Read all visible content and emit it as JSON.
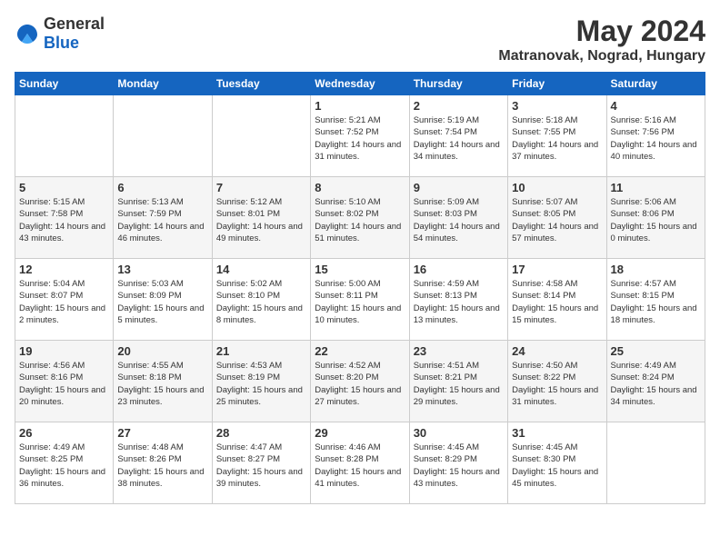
{
  "logo": {
    "general": "General",
    "blue": "Blue"
  },
  "header": {
    "month": "May 2024",
    "location": "Matranovak, Nograd, Hungary"
  },
  "weekdays": [
    "Sunday",
    "Monday",
    "Tuesday",
    "Wednesday",
    "Thursday",
    "Friday",
    "Saturday"
  ],
  "weeks": [
    [
      {
        "day": "",
        "sunrise": "",
        "sunset": "",
        "daylight": ""
      },
      {
        "day": "",
        "sunrise": "",
        "sunset": "",
        "daylight": ""
      },
      {
        "day": "",
        "sunrise": "",
        "sunset": "",
        "daylight": ""
      },
      {
        "day": "1",
        "sunrise": "Sunrise: 5:21 AM",
        "sunset": "Sunset: 7:52 PM",
        "daylight": "Daylight: 14 hours and 31 minutes."
      },
      {
        "day": "2",
        "sunrise": "Sunrise: 5:19 AM",
        "sunset": "Sunset: 7:54 PM",
        "daylight": "Daylight: 14 hours and 34 minutes."
      },
      {
        "day": "3",
        "sunrise": "Sunrise: 5:18 AM",
        "sunset": "Sunset: 7:55 PM",
        "daylight": "Daylight: 14 hours and 37 minutes."
      },
      {
        "day": "4",
        "sunrise": "Sunrise: 5:16 AM",
        "sunset": "Sunset: 7:56 PM",
        "daylight": "Daylight: 14 hours and 40 minutes."
      }
    ],
    [
      {
        "day": "5",
        "sunrise": "Sunrise: 5:15 AM",
        "sunset": "Sunset: 7:58 PM",
        "daylight": "Daylight: 14 hours and 43 minutes."
      },
      {
        "day": "6",
        "sunrise": "Sunrise: 5:13 AM",
        "sunset": "Sunset: 7:59 PM",
        "daylight": "Daylight: 14 hours and 46 minutes."
      },
      {
        "day": "7",
        "sunrise": "Sunrise: 5:12 AM",
        "sunset": "Sunset: 8:01 PM",
        "daylight": "Daylight: 14 hours and 49 minutes."
      },
      {
        "day": "8",
        "sunrise": "Sunrise: 5:10 AM",
        "sunset": "Sunset: 8:02 PM",
        "daylight": "Daylight: 14 hours and 51 minutes."
      },
      {
        "day": "9",
        "sunrise": "Sunrise: 5:09 AM",
        "sunset": "Sunset: 8:03 PM",
        "daylight": "Daylight: 14 hours and 54 minutes."
      },
      {
        "day": "10",
        "sunrise": "Sunrise: 5:07 AM",
        "sunset": "Sunset: 8:05 PM",
        "daylight": "Daylight: 14 hours and 57 minutes."
      },
      {
        "day": "11",
        "sunrise": "Sunrise: 5:06 AM",
        "sunset": "Sunset: 8:06 PM",
        "daylight": "Daylight: 15 hours and 0 minutes."
      }
    ],
    [
      {
        "day": "12",
        "sunrise": "Sunrise: 5:04 AM",
        "sunset": "Sunset: 8:07 PM",
        "daylight": "Daylight: 15 hours and 2 minutes."
      },
      {
        "day": "13",
        "sunrise": "Sunrise: 5:03 AM",
        "sunset": "Sunset: 8:09 PM",
        "daylight": "Daylight: 15 hours and 5 minutes."
      },
      {
        "day": "14",
        "sunrise": "Sunrise: 5:02 AM",
        "sunset": "Sunset: 8:10 PM",
        "daylight": "Daylight: 15 hours and 8 minutes."
      },
      {
        "day": "15",
        "sunrise": "Sunrise: 5:00 AM",
        "sunset": "Sunset: 8:11 PM",
        "daylight": "Daylight: 15 hours and 10 minutes."
      },
      {
        "day": "16",
        "sunrise": "Sunrise: 4:59 AM",
        "sunset": "Sunset: 8:13 PM",
        "daylight": "Daylight: 15 hours and 13 minutes."
      },
      {
        "day": "17",
        "sunrise": "Sunrise: 4:58 AM",
        "sunset": "Sunset: 8:14 PM",
        "daylight": "Daylight: 15 hours and 15 minutes."
      },
      {
        "day": "18",
        "sunrise": "Sunrise: 4:57 AM",
        "sunset": "Sunset: 8:15 PM",
        "daylight": "Daylight: 15 hours and 18 minutes."
      }
    ],
    [
      {
        "day": "19",
        "sunrise": "Sunrise: 4:56 AM",
        "sunset": "Sunset: 8:16 PM",
        "daylight": "Daylight: 15 hours and 20 minutes."
      },
      {
        "day": "20",
        "sunrise": "Sunrise: 4:55 AM",
        "sunset": "Sunset: 8:18 PM",
        "daylight": "Daylight: 15 hours and 23 minutes."
      },
      {
        "day": "21",
        "sunrise": "Sunrise: 4:53 AM",
        "sunset": "Sunset: 8:19 PM",
        "daylight": "Daylight: 15 hours and 25 minutes."
      },
      {
        "day": "22",
        "sunrise": "Sunrise: 4:52 AM",
        "sunset": "Sunset: 8:20 PM",
        "daylight": "Daylight: 15 hours and 27 minutes."
      },
      {
        "day": "23",
        "sunrise": "Sunrise: 4:51 AM",
        "sunset": "Sunset: 8:21 PM",
        "daylight": "Daylight: 15 hours and 29 minutes."
      },
      {
        "day": "24",
        "sunrise": "Sunrise: 4:50 AM",
        "sunset": "Sunset: 8:22 PM",
        "daylight": "Daylight: 15 hours and 31 minutes."
      },
      {
        "day": "25",
        "sunrise": "Sunrise: 4:49 AM",
        "sunset": "Sunset: 8:24 PM",
        "daylight": "Daylight: 15 hours and 34 minutes."
      }
    ],
    [
      {
        "day": "26",
        "sunrise": "Sunrise: 4:49 AM",
        "sunset": "Sunset: 8:25 PM",
        "daylight": "Daylight: 15 hours and 36 minutes."
      },
      {
        "day": "27",
        "sunrise": "Sunrise: 4:48 AM",
        "sunset": "Sunset: 8:26 PM",
        "daylight": "Daylight: 15 hours and 38 minutes."
      },
      {
        "day": "28",
        "sunrise": "Sunrise: 4:47 AM",
        "sunset": "Sunset: 8:27 PM",
        "daylight": "Daylight: 15 hours and 39 minutes."
      },
      {
        "day": "29",
        "sunrise": "Sunrise: 4:46 AM",
        "sunset": "Sunset: 8:28 PM",
        "daylight": "Daylight: 15 hours and 41 minutes."
      },
      {
        "day": "30",
        "sunrise": "Sunrise: 4:45 AM",
        "sunset": "Sunset: 8:29 PM",
        "daylight": "Daylight: 15 hours and 43 minutes."
      },
      {
        "day": "31",
        "sunrise": "Sunrise: 4:45 AM",
        "sunset": "Sunset: 8:30 PM",
        "daylight": "Daylight: 15 hours and 45 minutes."
      },
      {
        "day": "",
        "sunrise": "",
        "sunset": "",
        "daylight": ""
      }
    ]
  ]
}
